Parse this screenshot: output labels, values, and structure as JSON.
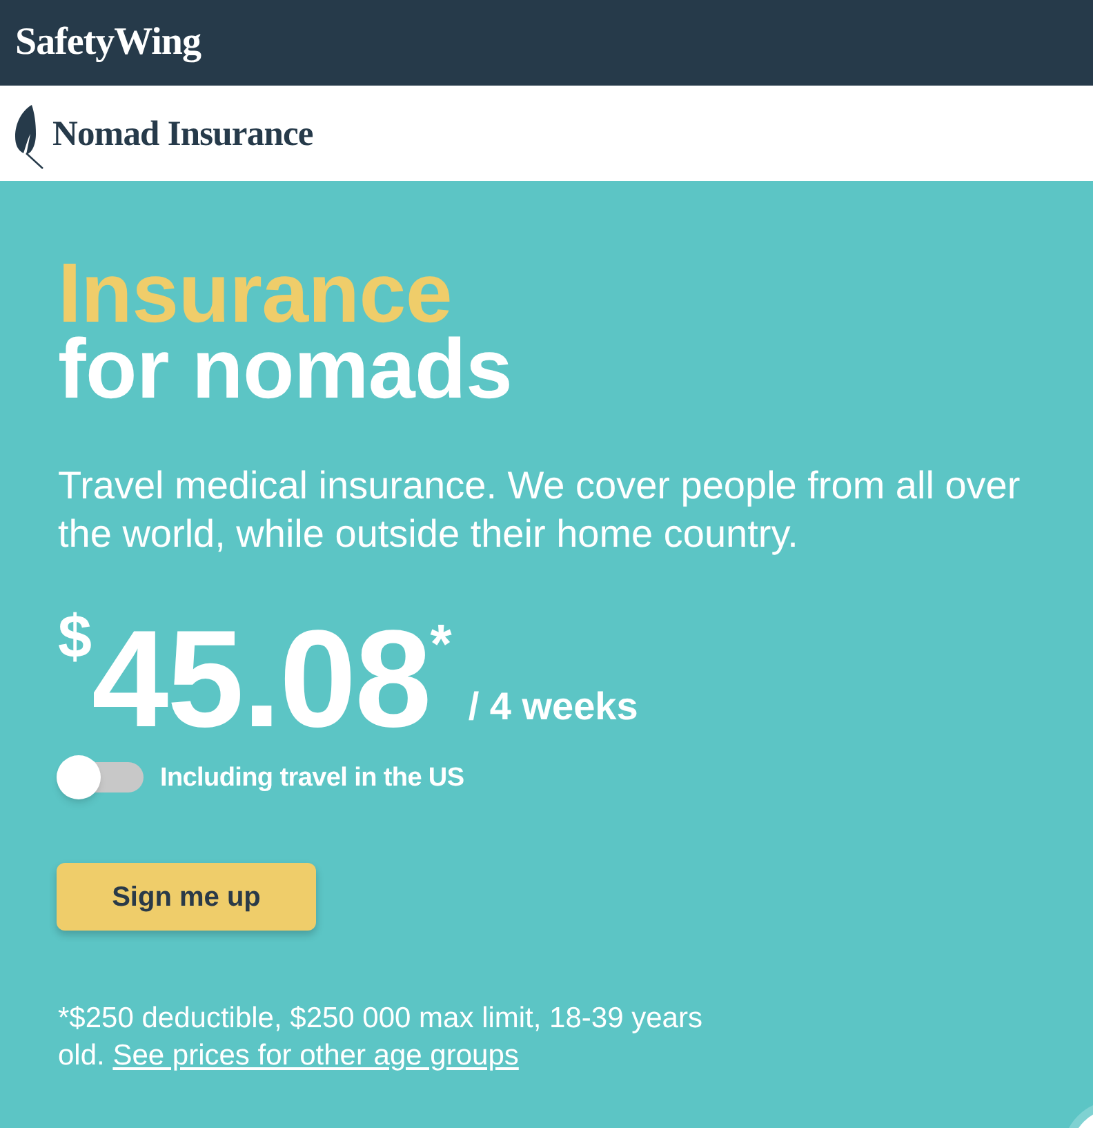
{
  "header": {
    "brand": "SafetyWing"
  },
  "product_bar": {
    "name": "Nomad Insurance"
  },
  "hero": {
    "title_lines": [
      {
        "text": "Insurance",
        "kind": "accent"
      },
      {
        "text": "for nomads",
        "kind": "plain"
      }
    ],
    "description": "Travel medical insurance. We cover people from all over the world, while outside their home country.",
    "price": {
      "currency": "$",
      "amount": "45.08",
      "mark": "*",
      "period": "/ 4 weeks"
    },
    "toggle": {
      "label": "Including travel in the US",
      "on": false
    },
    "cta": "Sign me up",
    "footnote": {
      "text": "*$250 deductible, $250 000 max limit, 18-39 years old.",
      "link": "See prices for other age groups"
    }
  }
}
